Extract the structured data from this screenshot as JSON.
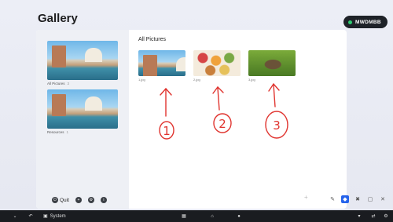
{
  "app": {
    "title": "Gallery",
    "device_label": "MWDMBB",
    "status_color": "#2ecc71"
  },
  "sidebar": {
    "albums": [
      {
        "label": "All Pictures",
        "count": "3"
      },
      {
        "label": "Resources",
        "count": "1"
      }
    ],
    "quit_label": "Quit"
  },
  "main": {
    "title": "All Pictures",
    "pictures": [
      {
        "name": "1.jpg",
        "image": "venice-canal"
      },
      {
        "name": "2.jpg",
        "image": "food-bowls"
      },
      {
        "name": "3.jpg",
        "image": "hedgehog"
      }
    ],
    "annotations": [
      "1",
      "2",
      "3"
    ]
  },
  "taskbar": {
    "system_label": "System"
  },
  "icons": {
    "quit": "power-icon",
    "add": "plus-icon",
    "settings": "gear-icon",
    "info": "info-icon",
    "pen": "pen-icon",
    "eraser": "eraser-icon",
    "delete": "trash-icon",
    "export": "export-icon",
    "close": "close-icon"
  },
  "colors": {
    "accent": "#2563eb",
    "annotation": "#e0342f"
  }
}
